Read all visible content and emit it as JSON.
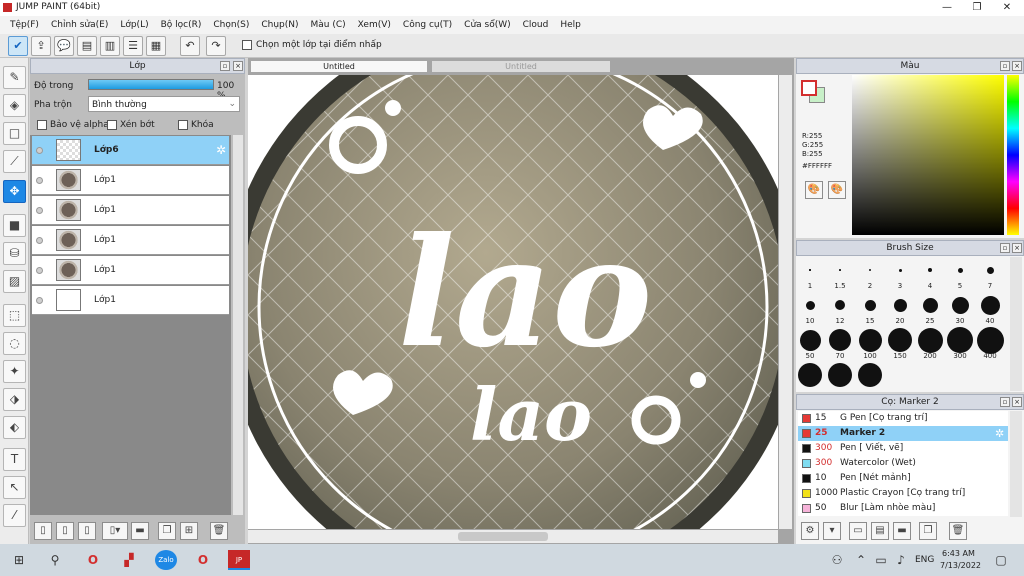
{
  "app": {
    "title": "JUMP PAINT (64bit)",
    "min": "—",
    "max": "❐",
    "close": "✕"
  },
  "menu": [
    "Tệp(F)",
    "Chỉnh sửa(E)",
    "Lớp(L)",
    "Bộ lọc(R)",
    "Chọn(S)",
    "Chụp(N)",
    "Màu (C)",
    "Xem(V)",
    "Công cụ(T)",
    "Cửa sổ(W)",
    "Cloud",
    "Help"
  ],
  "toolbar": {
    "pick_layer_label": "Chọn một lớp tại điểm nhấp"
  },
  "layers": {
    "title": "Lớp",
    "opacity_label": "Độ trong",
    "opacity_value": "100 %",
    "opacity": 1.0,
    "blend_label": "Pha trộn",
    "blend_value": "Bình thường",
    "protect_alpha": "Bảo vệ alpha",
    "clip": "Xén bớt",
    "lock": "Khóa",
    "rows": [
      "Lớp6",
      "Lớp1",
      "Lớp1",
      "Lớp1",
      "Lớp1",
      "Lớp1"
    ]
  },
  "canvas": {
    "tab_active": "Untitled",
    "tab_inactive": "Untitled"
  },
  "color": {
    "title": "Màu",
    "r": "R:255",
    "g": "G:255",
    "b": "B:255",
    "hex": "#FFFFFF",
    "current": "#ffffff",
    "prev": "#c8f0c8"
  },
  "brush": {
    "title": "Brush Size",
    "sizes": [
      "1",
      "1.5",
      "2",
      "3",
      "4",
      "5",
      "7",
      "10",
      "12",
      "15",
      "20",
      "25",
      "30",
      "40",
      "50",
      "70",
      "100",
      "150",
      "200",
      "300",
      "400"
    ]
  },
  "tools_panel": {
    "title": "Cọ: Marker 2",
    "items": [
      {
        "size": "15",
        "name": "G Pen [Cọ trang trí]",
        "color": "#e53935"
      },
      {
        "size": "25",
        "name": "Marker 2",
        "color": "#e53935"
      },
      {
        "size": "300",
        "name": "Pen [ Viết, vẽ]",
        "color": "#111111"
      },
      {
        "size": "300",
        "name": "Watercolor (Wet)",
        "color": "#7fdcf0"
      },
      {
        "size": "10",
        "name": "Pen [Nét mảnh]",
        "color": "#111111"
      },
      {
        "size": "1000",
        "name": "Plastic Crayon [Cọ trang trí]",
        "color": "#f1e11a"
      },
      {
        "size": "50",
        "name": "Blur [Làm nhòe màu]",
        "color": "#f6b3d9"
      }
    ]
  },
  "taskbar": {
    "lang": "ENG",
    "time": "6:43 AM",
    "date": "7/13/2022"
  }
}
